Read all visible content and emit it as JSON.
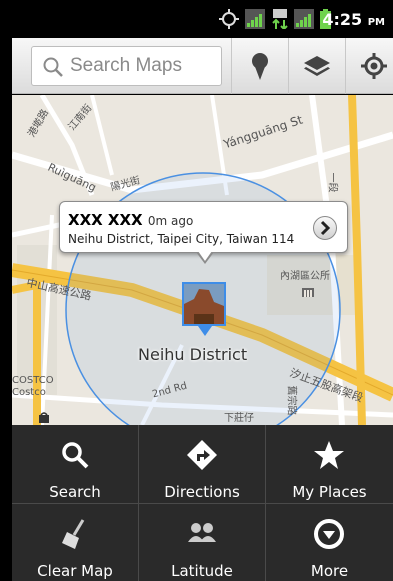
{
  "status": {
    "time": "4:25",
    "ampm": "PM",
    "icons": [
      "gps-icon",
      "signal-s2-icon",
      "data-transfer-icon",
      "signal-s1-icon",
      "battery-icon"
    ]
  },
  "toolbar": {
    "search_placeholder": "Search Maps",
    "buttons": [
      "pin-icon",
      "layers-icon",
      "my-location-icon"
    ]
  },
  "map": {
    "labels": [
      {
        "text": "港墘路"
      },
      {
        "text": "江南街"
      },
      {
        "text": "Yángguāng St"
      },
      {
        "text": "Ruìguāng"
      },
      {
        "text": "陽光街"
      },
      {
        "text": "一段"
      },
      {
        "text": "中山高速公路"
      },
      {
        "text": "內湖區公所"
      },
      {
        "text": "COSTCO"
      },
      {
        "text": "Costco"
      },
      {
        "text": "2nd Rd"
      },
      {
        "text": "下莊仔"
      },
      {
        "text": "舊宗路"
      },
      {
        "text": "汐止五股高架段"
      }
    ],
    "district": "Neihu District"
  },
  "balloon": {
    "name": "XXX XXX",
    "ago": "0m ago",
    "address": "Neihu District, Taipei City, Taiwan 114"
  },
  "menu": {
    "items": [
      {
        "label": "Search",
        "icon": "search-icon"
      },
      {
        "label": "Directions",
        "icon": "directions-icon"
      },
      {
        "label": "My Places",
        "icon": "star-icon"
      },
      {
        "label": "Clear Map",
        "icon": "broom-icon"
      },
      {
        "label": "Latitude",
        "icon": "latitude-people-icon"
      },
      {
        "label": "More",
        "icon": "more-icon"
      }
    ]
  },
  "colors": {
    "accuracy_circle": "#4a90e2",
    "highway": "#f5c343",
    "map_bg": "#ebe7df",
    "menu_bg": "#2a2a2a"
  }
}
